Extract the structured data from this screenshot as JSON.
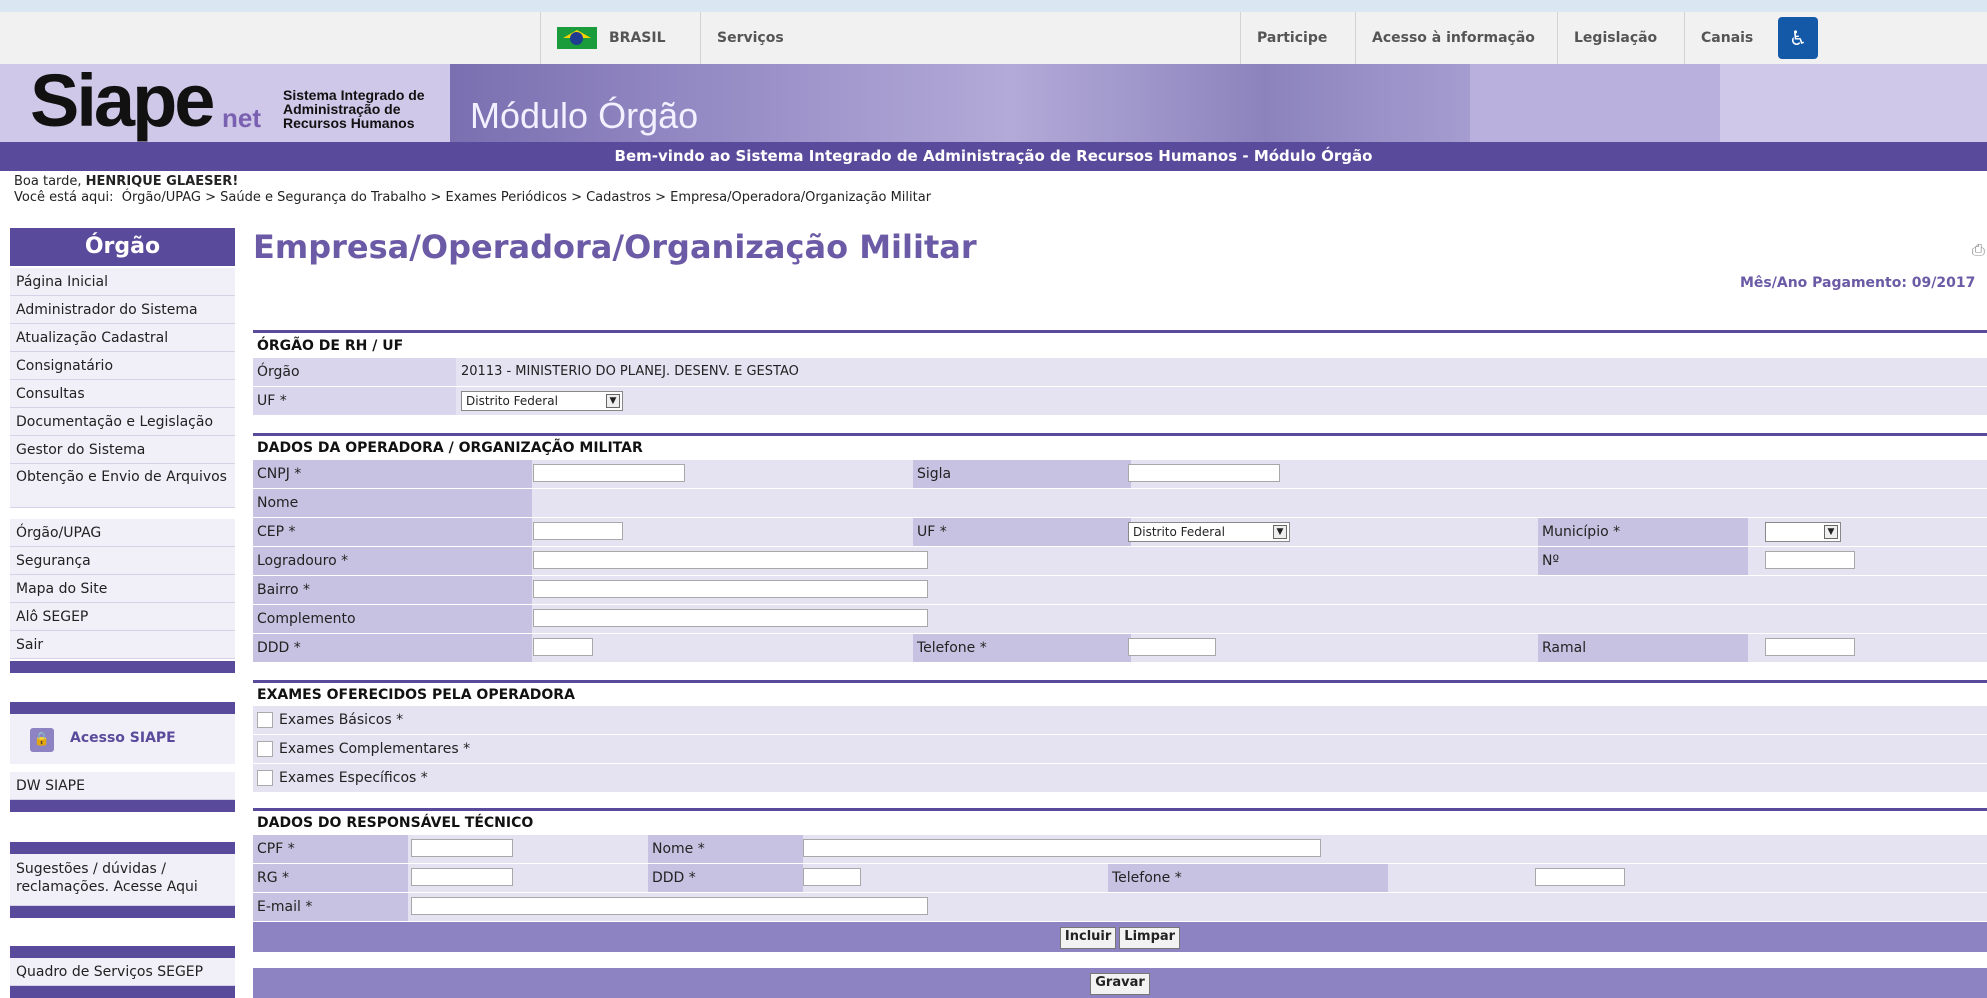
{
  "gov_bar": {
    "brasil": "BRASIL",
    "servicos": "Serviços",
    "participe": "Participe",
    "acesso_info": "Acesso à informação",
    "legislacao": "Legislação",
    "canais": "Canais"
  },
  "header": {
    "logo": "Siape",
    "logo_suffix": "net",
    "logo_sub_1": "Sistema Integrado de",
    "logo_sub_2": "Administração de",
    "logo_sub_3": "Recursos Humanos",
    "module": "Módulo Órgão",
    "welcome": "Bem-vindo ao Sistema Integrado de Administração de Recursos Humanos - Módulo Órgão"
  },
  "greeting": {
    "prefix": "Boa tarde, ",
    "user": "HENRIQUE GLAESER!",
    "breadcrumb_label": "Você está aqui:",
    "breadcrumb": "Órgão/UPAG > Saúde e Segurança do Trabalho > Exames Periódicos > Cadastros > Empresa/Operadora/Organização Militar"
  },
  "sidebar": {
    "title": "Órgão",
    "items": [
      "Página Inicial",
      "Administrador do Sistema",
      "Atualização Cadastral",
      "Consignatário",
      "Consultas",
      "Documentação e Legislação",
      "Gestor do Sistema",
      "Obtenção e Envio de Arquivos",
      "Órgão/UPAG",
      "Segurança",
      "Mapa do Site",
      "Alô SEGEP",
      "Sair"
    ],
    "acesso_siape": "Acesso SIAPE",
    "dw_siape": "DW SIAPE",
    "sugestoes": "Sugestões / dúvidas / reclamações. Acesse Aqui",
    "quadro": "Quadro de Serviços SEGEP"
  },
  "main": {
    "title": "Empresa/Operadora/Organização Militar",
    "mes_ano": "Mês/Ano Pagamento: 09/2017"
  },
  "orgao_section": {
    "title": "ÓRGÃO DE RH / UF",
    "orgao_label": "Órgão",
    "orgao_value": "20113 - MINISTERIO DO PLANEJ. DESENV. E GESTAO",
    "uf_label": "UF *",
    "uf_value": "Distrito Federal"
  },
  "operadora_section": {
    "title": "DADOS DA OPERADORA / ORGANIZAÇÃO MILITAR",
    "cnpj": "CNPJ *",
    "sigla": "Sigla",
    "nome": "Nome",
    "cep": "CEP *",
    "uf": "UF *",
    "uf_value": "Distrito Federal",
    "municipio": "Município *",
    "logradouro": "Logradouro *",
    "numero": "Nº",
    "bairro": "Bairro *",
    "complemento": "Complemento",
    "ddd": "DDD *",
    "telefone": "Telefone *",
    "ramal": "Ramal"
  },
  "exames_section": {
    "title": "EXAMES OFERECIDOS PELA OPERADORA",
    "basicos": "Exames Básicos *",
    "complementares": "Exames Complementares *",
    "especificos": "Exames Específicos *"
  },
  "responsavel_section": {
    "title": "DADOS DO RESPONSÁVEL TÉCNICO",
    "cpf": "CPF *",
    "nome": "Nome *",
    "rg": "RG *",
    "ddd": "DDD *",
    "telefone": "Telefone *",
    "email": "E-mail *"
  },
  "buttons": {
    "incluir": "Incluir",
    "limpar": "Limpar",
    "gravar": "Gravar"
  }
}
